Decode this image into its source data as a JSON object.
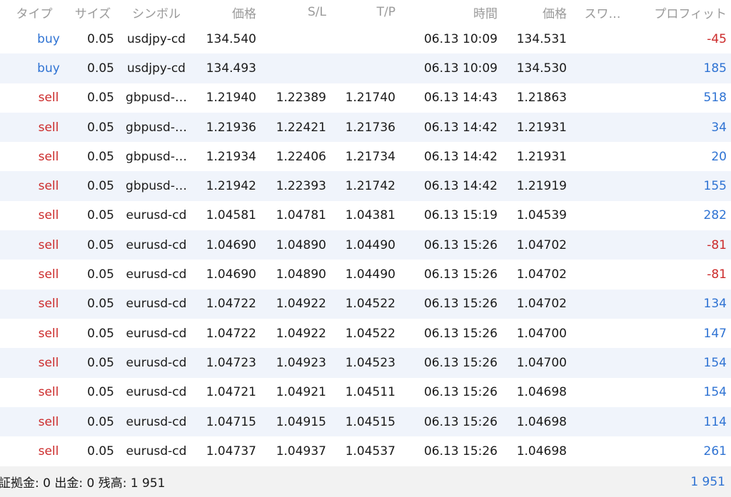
{
  "header": {
    "type": "タイプ",
    "size": "サイズ",
    "symbol": "シンボル",
    "price": "価格",
    "sl": "S/L",
    "tp": "T/P",
    "time": "時間",
    "current_price": "価格",
    "swap": "スワ…",
    "profit": "プロフィット"
  },
  "rows": [
    {
      "type": "buy",
      "size": "0.05",
      "symbol": "usdjpy-cd",
      "price": "134.540",
      "sl": "",
      "tp": "",
      "time": "06.13 10:09",
      "current": "134.531",
      "profit": "-45"
    },
    {
      "type": "buy",
      "size": "0.05",
      "symbol": "usdjpy-cd",
      "price": "134.493",
      "sl": "",
      "tp": "",
      "time": "06.13 10:09",
      "current": "134.530",
      "profit": "185"
    },
    {
      "type": "sell",
      "size": "0.05",
      "symbol": "gbpusd-…",
      "price": "1.21940",
      "sl": "1.22389",
      "tp": "1.21740",
      "time": "06.13 14:43",
      "current": "1.21863",
      "profit": "518"
    },
    {
      "type": "sell",
      "size": "0.05",
      "symbol": "gbpusd-…",
      "price": "1.21936",
      "sl": "1.22421",
      "tp": "1.21736",
      "time": "06.13 14:42",
      "current": "1.21931",
      "profit": "34"
    },
    {
      "type": "sell",
      "size": "0.05",
      "symbol": "gbpusd-…",
      "price": "1.21934",
      "sl": "1.22406",
      "tp": "1.21734",
      "time": "06.13 14:42",
      "current": "1.21931",
      "profit": "20"
    },
    {
      "type": "sell",
      "size": "0.05",
      "symbol": "gbpusd-…",
      "price": "1.21942",
      "sl": "1.22393",
      "tp": "1.21742",
      "time": "06.13 14:42",
      "current": "1.21919",
      "profit": "155"
    },
    {
      "type": "sell",
      "size": "0.05",
      "symbol": "eurusd-cd",
      "price": "1.04581",
      "sl": "1.04781",
      "tp": "1.04381",
      "time": "06.13 15:19",
      "current": "1.04539",
      "profit": "282"
    },
    {
      "type": "sell",
      "size": "0.05",
      "symbol": "eurusd-cd",
      "price": "1.04690",
      "sl": "1.04890",
      "tp": "1.04490",
      "time": "06.13 15:26",
      "current": "1.04702",
      "profit": "-81"
    },
    {
      "type": "sell",
      "size": "0.05",
      "symbol": "eurusd-cd",
      "price": "1.04690",
      "sl": "1.04890",
      "tp": "1.04490",
      "time": "06.13 15:26",
      "current": "1.04702",
      "profit": "-81"
    },
    {
      "type": "sell",
      "size": "0.05",
      "symbol": "eurusd-cd",
      "price": "1.04722",
      "sl": "1.04922",
      "tp": "1.04522",
      "time": "06.13 15:26",
      "current": "1.04702",
      "profit": "134"
    },
    {
      "type": "sell",
      "size": "0.05",
      "symbol": "eurusd-cd",
      "price": "1.04722",
      "sl": "1.04922",
      "tp": "1.04522",
      "time": "06.13 15:26",
      "current": "1.04700",
      "profit": "147"
    },
    {
      "type": "sell",
      "size": "0.05",
      "symbol": "eurusd-cd",
      "price": "1.04723",
      "sl": "1.04923",
      "tp": "1.04523",
      "time": "06.13 15:26",
      "current": "1.04700",
      "profit": "154"
    },
    {
      "type": "sell",
      "size": "0.05",
      "symbol": "eurusd-cd",
      "price": "1.04721",
      "sl": "1.04921",
      "tp": "1.04511",
      "time": "06.13 15:26",
      "current": "1.04698",
      "profit": "154"
    },
    {
      "type": "sell",
      "size": "0.05",
      "symbol": "eurusd-cd",
      "price": "1.04715",
      "sl": "1.04915",
      "tp": "1.04515",
      "time": "06.13 15:26",
      "current": "1.04698",
      "profit": "114"
    },
    {
      "type": "sell",
      "size": "0.05",
      "symbol": "eurusd-cd",
      "price": "1.04737",
      "sl": "1.04937",
      "tp": "1.04537",
      "time": "06.13 15:26",
      "current": "1.04698",
      "profit": "261"
    }
  ],
  "footer": {
    "summary": "証拠金: 0 出金: 0 残高: 1 951",
    "total": "1 951"
  },
  "colors": {
    "buy": "#2f73d3",
    "sell": "#cc2b2b",
    "profit_positive": "#2f73d3",
    "profit_negative": "#cc2b2b",
    "row_alt_bg": "#f0f4fb",
    "header_text": "#9a9a9a"
  }
}
